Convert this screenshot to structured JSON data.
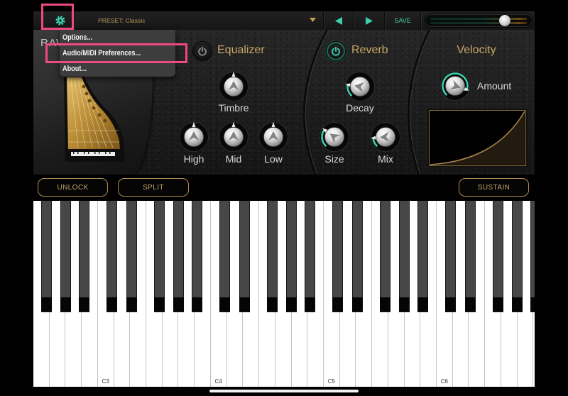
{
  "app": {
    "logo_text": "RAV"
  },
  "topbar": {
    "settings_icon": "gear-icon",
    "preset_label": "PRESET: Classic",
    "preset_dropdown_icon": "caret-down-icon",
    "prev_icon": "triangle-left-icon",
    "next_icon": "triangle-right-icon",
    "save_label": "SAVE",
    "volume": 0.77
  },
  "settings_menu": {
    "items": [
      {
        "label": "Options..."
      },
      {
        "label": "Audio/MIDI Preferences..."
      },
      {
        "label": "About..."
      }
    ],
    "highlighted_item": "Audio/MIDI Preferences..."
  },
  "equalizer": {
    "title": "Equalizer",
    "power_on": false,
    "knobs": [
      {
        "label": "Timbre",
        "value": 0.5,
        "mode": "bipolar"
      },
      {
        "label": "High",
        "value": 0.5,
        "mode": "bipolar"
      },
      {
        "label": "Mid",
        "value": 0.5,
        "mode": "bipolar"
      },
      {
        "label": "Low",
        "value": 0.5,
        "mode": "bipolar"
      }
    ]
  },
  "reverb": {
    "title": "Reverb",
    "power_on": true,
    "knobs": [
      {
        "label": "Decay",
        "value": 0.2,
        "mode": "unipolar"
      },
      {
        "label": "Size",
        "value": 0.3,
        "mode": "unipolar"
      },
      {
        "label": "Mix",
        "value": 0.15,
        "mode": "unipolar"
      }
    ]
  },
  "velocity": {
    "title": "Velocity",
    "amount": {
      "label": "Amount",
      "value": 0.9,
      "mode": "unipolar"
    },
    "curve": "exponential"
  },
  "buttons": {
    "unlock": "UNLOCK",
    "split": "SPLIT",
    "sustain": "SUSTAIN"
  },
  "keyboard": {
    "first_white_note": "F2",
    "white_key_count": 31,
    "octave_labels": [
      "C3",
      "C4",
      "C5",
      "C6"
    ]
  },
  "colors": {
    "accent_teal": "#3fcfae",
    "gold": "#c9a766",
    "highlight": "#ee4a7e"
  }
}
